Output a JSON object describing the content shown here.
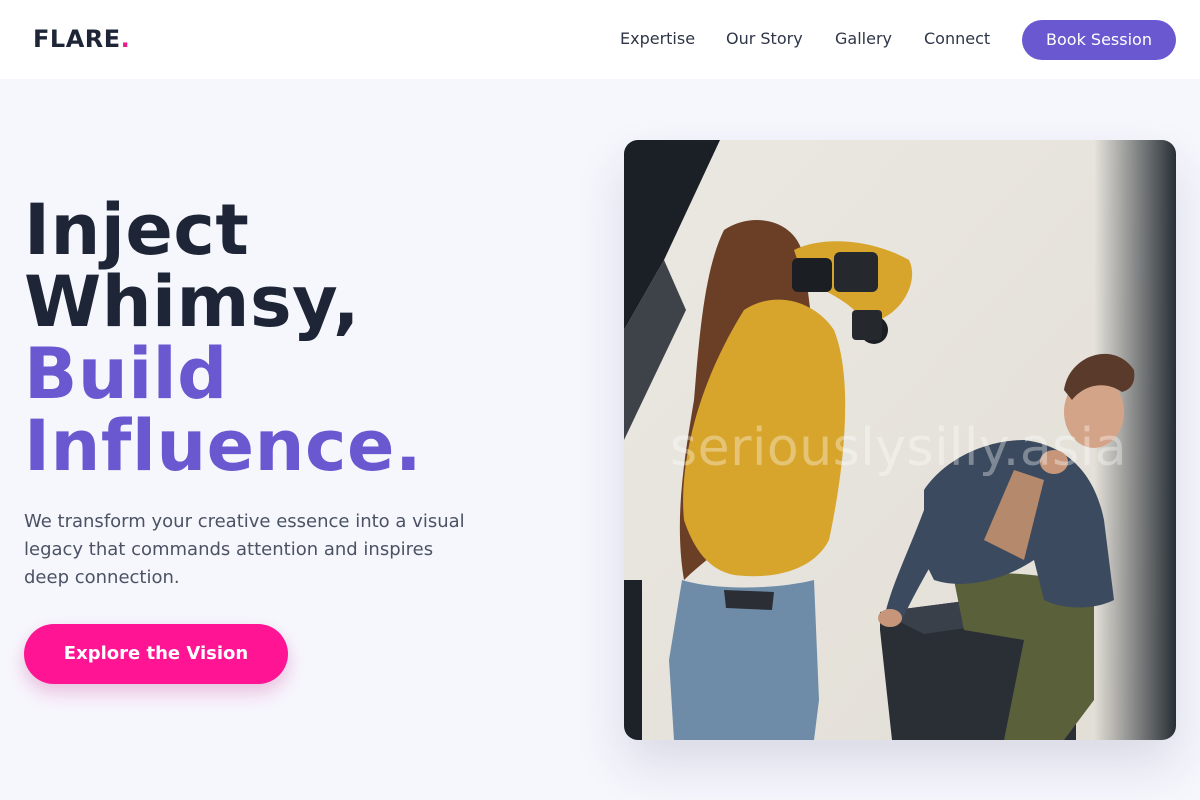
{
  "header": {
    "logo_text": "FLARE",
    "logo_dot": ".",
    "nav": {
      "expertise": "Expertise",
      "our_story": "Our Story",
      "gallery": "Gallery",
      "connect": "Connect"
    },
    "cta_label": "Book Session"
  },
  "hero": {
    "title_line1": "Inject",
    "title_line2": "Whimsy,",
    "title_line3": "Build",
    "title_line4": "Influence.",
    "subtitle_line1": "We transform your creative essence into a visual",
    "subtitle_line2": "legacy that commands attention and inspires",
    "subtitle_line3": "deep connection.",
    "cta_label": "Explore the Vision"
  },
  "photo": {
    "watermark": "seriouslysilly.asia"
  },
  "colors": {
    "brand_accent": "#6a58d0",
    "cta_pink": "#ff1493",
    "logo_dot": "#e91e8c",
    "heading_dark": "#1d2537",
    "page_bg": "#f6f7fd"
  }
}
